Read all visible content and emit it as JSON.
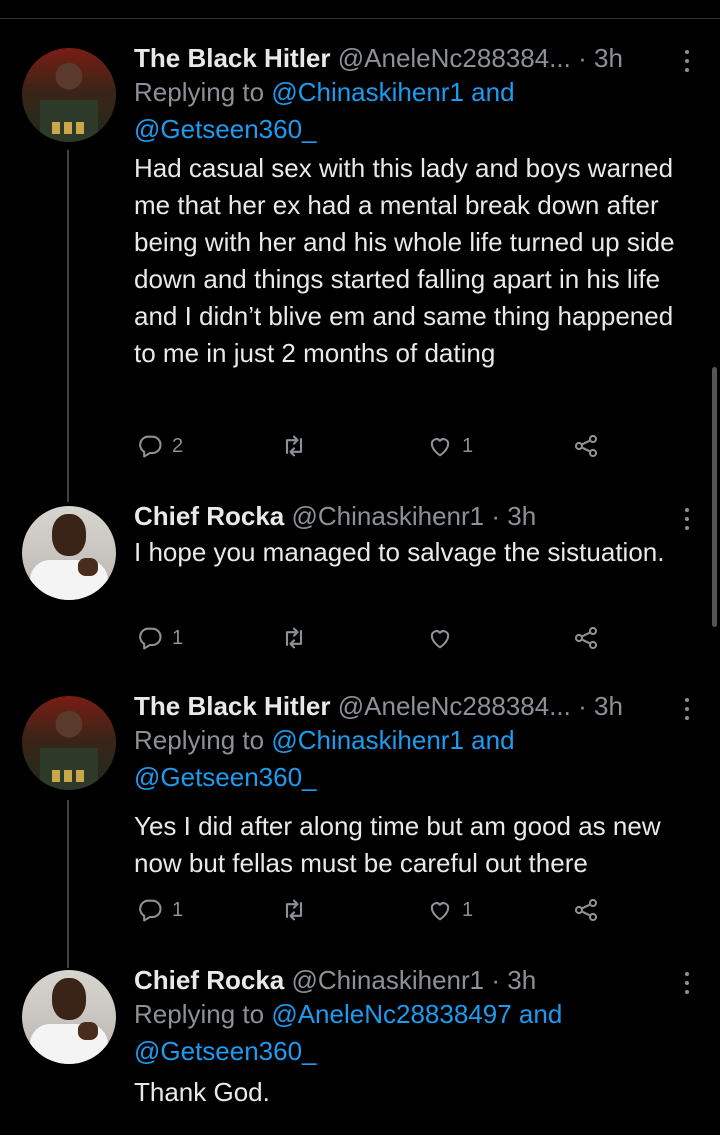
{
  "tweets": [
    {
      "name": "The Black Hitler",
      "handle": "@AneleNc288384...",
      "dot": "·",
      "time": "3h",
      "replying_prefix": "Replying to ",
      "replying_mention1": "@Chinaskihenr1",
      "replying_and": " and",
      "replying_mention2": "@Getseen360_",
      "text": "Had casual sex with this lady and boys warned me that her ex had a mental break down after being with her and his whole life turned up side down and things started falling apart in his life and I didn’t blive em and same thing happened to me in just 2 months of dating",
      "replies": "2",
      "retweets": "",
      "likes": "1",
      "avatar": "uniform-avatar"
    },
    {
      "name": "Chief Rocka",
      "handle": "@Chinaskihenr1",
      "dot": "·",
      "time": "3h",
      "text": "I hope you managed to salvage the sistuation.",
      "replies": "1",
      "retweets": "",
      "likes": "",
      "avatar": "white-shirt-avatar"
    },
    {
      "name": "The Black Hitler",
      "handle": "@AneleNc288384...",
      "dot": "·",
      "time": "3h",
      "replying_prefix": "Replying to ",
      "replying_mention1": "@Chinaskihenr1",
      "replying_and": " and",
      "replying_mention2": "@Getseen360_",
      "text": "Yes I did after along time but am good as new now but fellas must be careful out there",
      "replies": "1",
      "retweets": "",
      "likes": "1",
      "avatar": "uniform-avatar"
    },
    {
      "name": "Chief Rocka",
      "handle": "@Chinaskihenr1",
      "dot": "·",
      "time": "3h",
      "replying_prefix": "Replying to ",
      "replying_mention1": "@AneleNc28838497",
      "replying_and": " and",
      "replying_mention2": "@Getseen360_",
      "text": "Thank God.",
      "avatar": "white-shirt-avatar"
    }
  ],
  "colors": {
    "background": "#000000",
    "text": "#e7e9ea",
    "muted": "#8b9197",
    "link": "#1d9bf0"
  }
}
